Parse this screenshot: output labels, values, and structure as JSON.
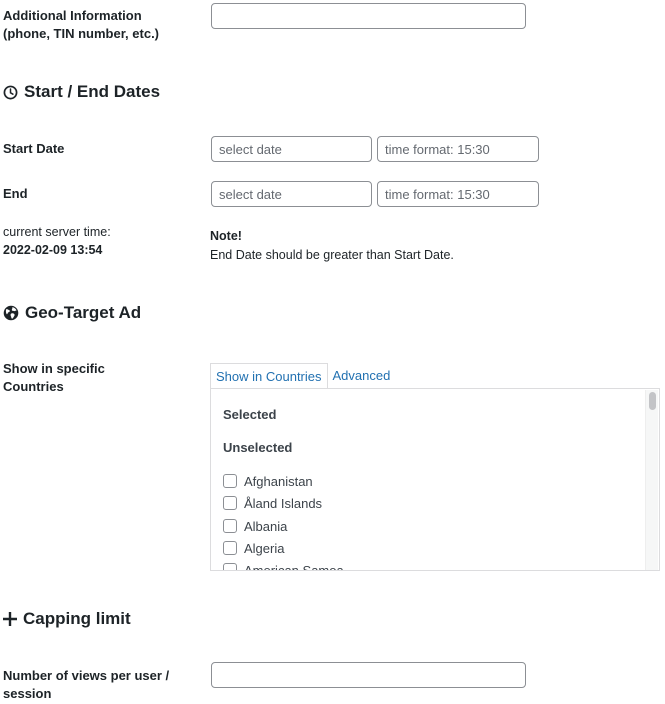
{
  "additional_info": {
    "label_line1": "Additional Information",
    "label_line2": "(phone, TIN number, etc.)",
    "value": ""
  },
  "dates_section": {
    "title": "Start / End Dates",
    "icon": "clock-icon",
    "start_label": "Start Date",
    "end_label": "End",
    "date_placeholder": "select date",
    "time_placeholder": "time format: 15:30",
    "server_time_label": "current server time:",
    "server_time_value": "2022-02-09 13:54",
    "note_title": "Note!",
    "note_text": "End Date should be greater than Start Date."
  },
  "geo_section": {
    "title": "Geo-Target Ad",
    "icon": "globe-icon",
    "label_line1": "Show in specific",
    "label_line2": "Countries",
    "tabs": [
      "Show in Countries",
      "Advanced"
    ],
    "active_tab": "Show in Countries",
    "selected_heading": "Selected",
    "unselected_heading": "Unselected",
    "countries": [
      "Afghanistan",
      "Åland Islands",
      "Albania",
      "Algeria",
      "American Samoa"
    ]
  },
  "capping_section": {
    "title": "Capping limit",
    "icon": "plus-icon",
    "label_line1": "Number of views per user /",
    "label_line2": "session",
    "value": ""
  },
  "colors": {
    "link": "#2271b1",
    "text": "#1d2327",
    "border": "#8c8f94"
  }
}
